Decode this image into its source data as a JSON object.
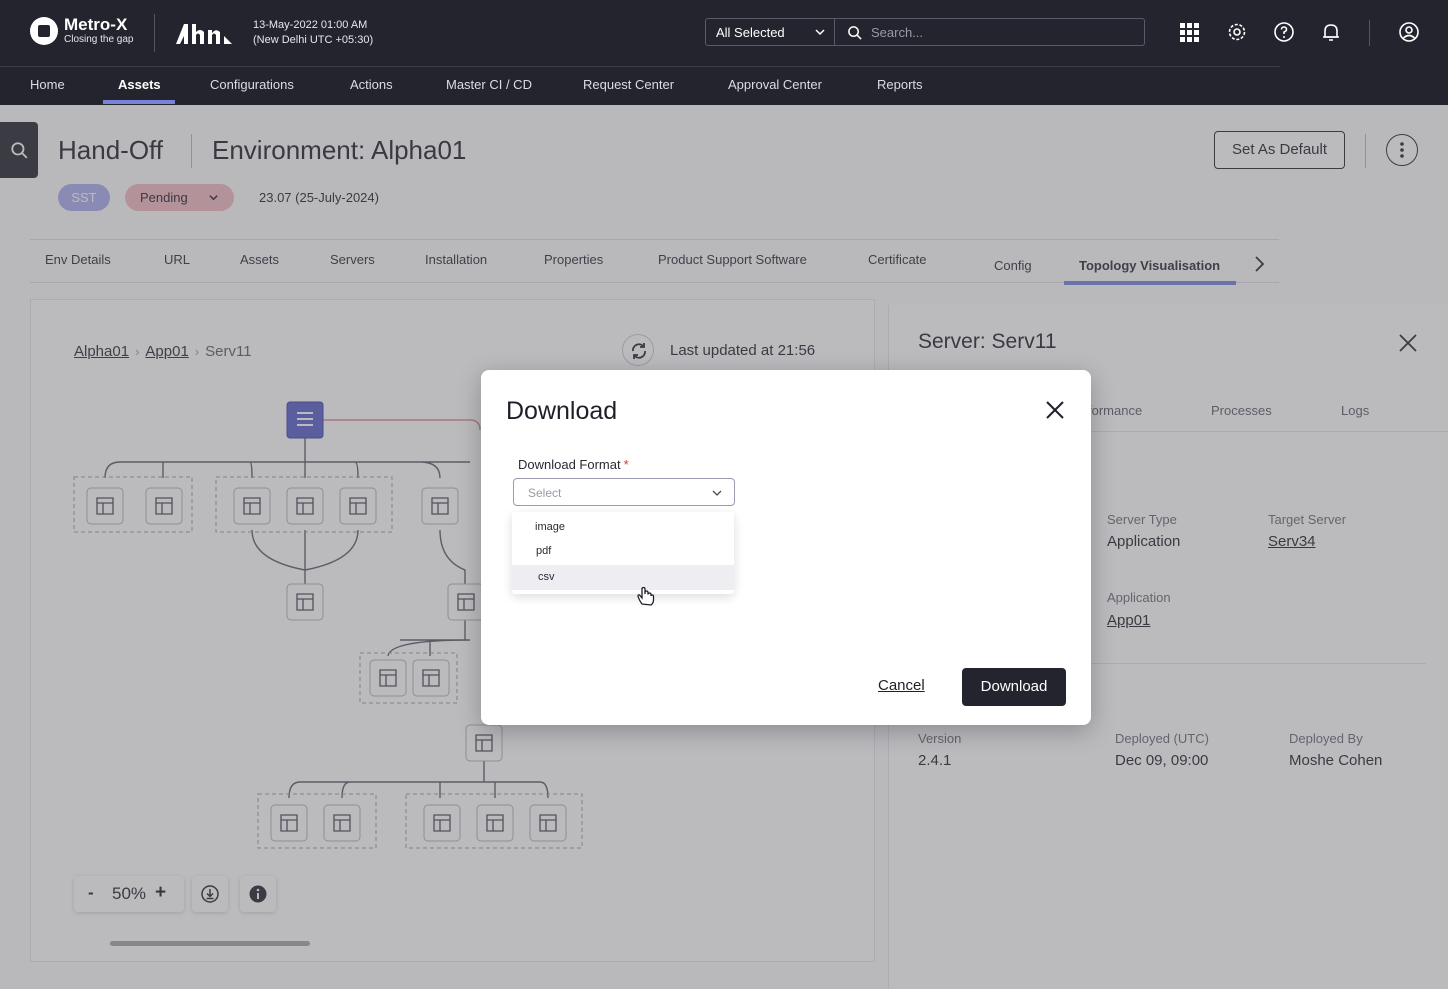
{
  "app": {
    "logo_name": "Metro-X",
    "logo_tagline": "Closing the gap",
    "datetime_line1": "13-May-2022 01:00 AM",
    "datetime_line2": "(New Delhi UTC +05:30)",
    "scope_selected": "All Selected",
    "search_placeholder": "Search..."
  },
  "nav": {
    "items": [
      "Home",
      "Assets",
      "Configurations",
      "Actions",
      "Master CI / CD",
      "Request Center",
      "Approval Center",
      "Reports"
    ],
    "active": "Assets"
  },
  "header": {
    "title": "Hand-Off",
    "environment": "Environment: Alpha01",
    "set_default_label": "Set As Default",
    "badge_sst": "SST",
    "badge_status": "Pending",
    "version": "23.07 (25-July-2024)"
  },
  "tabs": {
    "items": [
      "Env Details",
      "URL",
      "Assets",
      "Servers",
      "Installation",
      "Properties",
      "Product Support Software",
      "Certificate",
      "Config",
      "Topology Visualisation"
    ],
    "active": "Topology Visualisation"
  },
  "canvas": {
    "breadcrumb": [
      "Alpha01",
      "App01",
      "Serv11"
    ],
    "last_updated": "Last updated at 21:56",
    "zoom_minus": "-",
    "zoom_value": "50%",
    "zoom_plus": "+"
  },
  "side_panel": {
    "title": "Server: Serv11",
    "tabs": [
      "formance",
      "Processes",
      "Logs"
    ],
    "server_type_label": "Server Type",
    "server_type_value": "Application",
    "target_server_label": "Target Server",
    "target_server_value": "Serv34",
    "application_label": "Application",
    "application_value": "App01",
    "version_label": "Version",
    "version_value": "2.4.1",
    "deployed_label": "Deployed (UTC)",
    "deployed_value": "Dec 09, 09:00",
    "deployed_by_label": "Deployed By",
    "deployed_by_value": "Moshe Cohen"
  },
  "modal": {
    "title": "Download",
    "field_label": "Download Format",
    "required_mark": "*",
    "select_placeholder": "Select",
    "options": [
      "image",
      "pdf",
      "csv"
    ],
    "hovered_option": "csv",
    "cancel_label": "Cancel",
    "download_label": "Download"
  },
  "colors": {
    "topbar": "#24242e",
    "accent": "#7b83d8",
    "node_selected": "#5a5fc8",
    "status_pending": "#f3b9bf",
    "required": "#d6343f"
  }
}
